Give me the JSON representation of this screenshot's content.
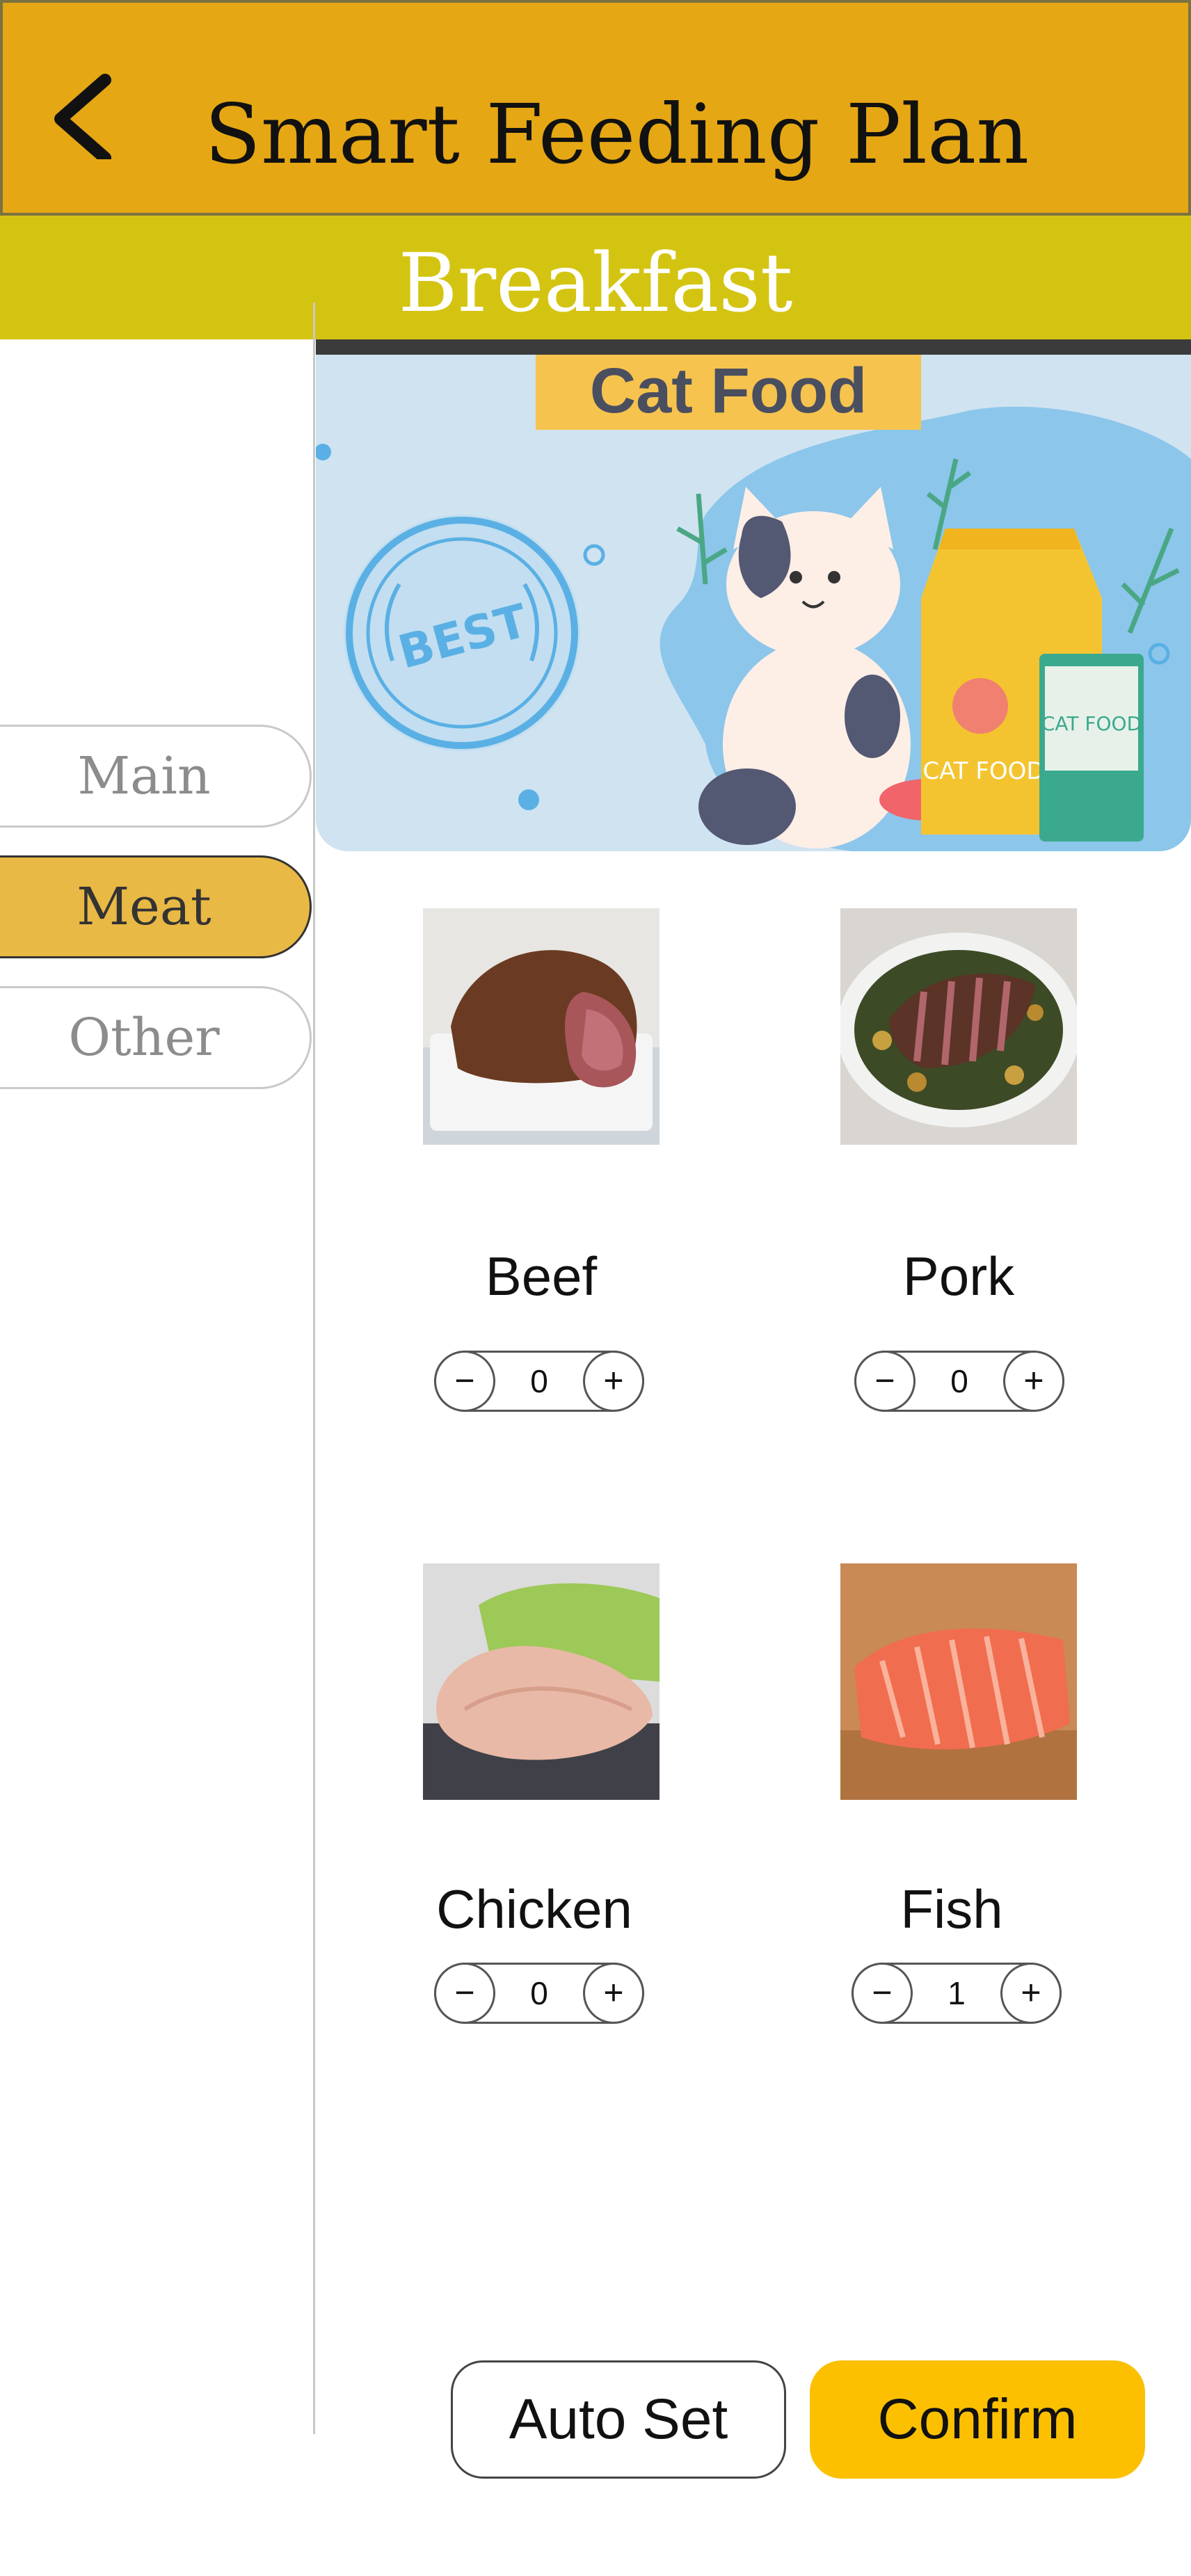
{
  "header": {
    "title": "Smart Feeding Plan",
    "back_icon": "chevron-left-icon"
  },
  "meal": {
    "label": "Breakfast"
  },
  "categories": [
    {
      "label": "Main",
      "active": false
    },
    {
      "label": "Meat",
      "active": true
    },
    {
      "label": "Other",
      "active": false
    }
  ],
  "banner": {
    "title": "Cat Food",
    "stamp_text": "BEST",
    "bag_text": "CAT FOOD",
    "box_text": "CAT FOOD"
  },
  "items": [
    {
      "name": "Beef",
      "quantity": "0"
    },
    {
      "name": "Pork",
      "quantity": "0"
    },
    {
      "name": "Chicken",
      "quantity": "0"
    },
    {
      "name": "Fish",
      "quantity": "1"
    }
  ],
  "stepper": {
    "minus": "−",
    "plus": "+"
  },
  "actions": {
    "auto_set": "Auto Set",
    "confirm": "Confirm"
  },
  "colors": {
    "header": "#e5a714",
    "subheader": "#d4c412",
    "active_category": "#e9b945",
    "confirm": "#fcc000"
  }
}
